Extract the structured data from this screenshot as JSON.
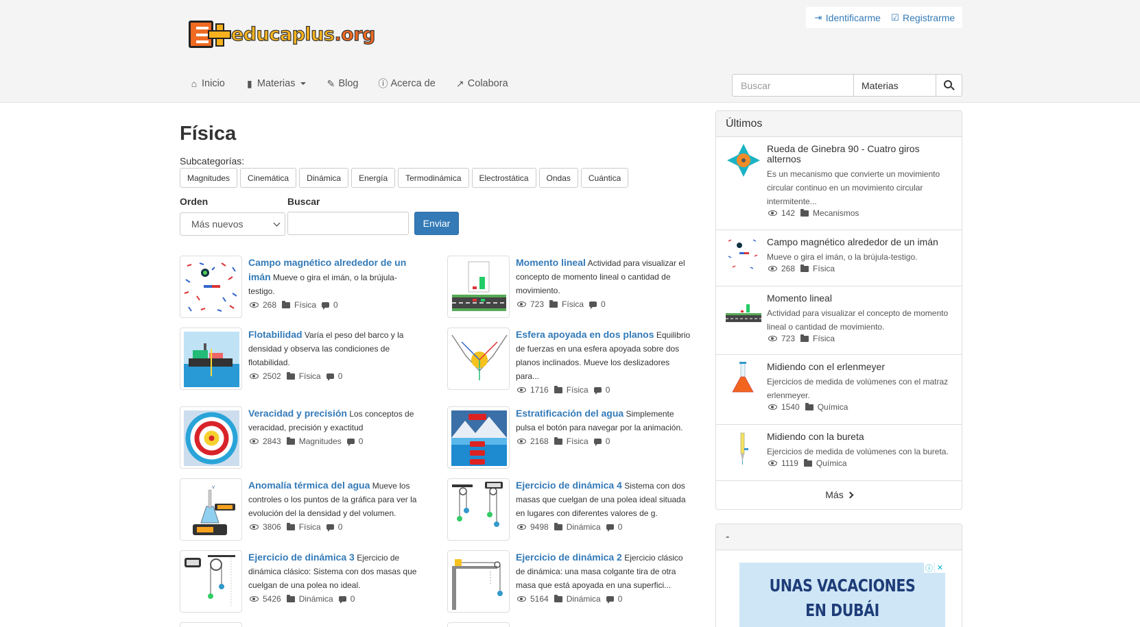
{
  "brand": {
    "logo_main": "educaplus",
    "logo_tld": ".org"
  },
  "auth": {
    "login": "Identificarme",
    "register": "Registrarme"
  },
  "nav": [
    {
      "label": "Inicio",
      "icon": "home-icon"
    },
    {
      "label": "Materias",
      "icon": "book-icon",
      "dropdown": true
    },
    {
      "label": "Blog",
      "icon": "pencil-icon"
    },
    {
      "label": "Acerca de",
      "icon": "info-icon"
    },
    {
      "label": "Colabora",
      "icon": "share-icon"
    }
  ],
  "search": {
    "placeholder": "Buscar",
    "scope": "Materias"
  },
  "page": {
    "title": "Física",
    "subcategories_label": "Subcategorías:",
    "subcategories": [
      "Magnitudes",
      "Cinemática",
      "Dinámica",
      "Energía",
      "Termodinámica",
      "Electrostática",
      "Ondas",
      "Cuántica"
    ],
    "order_label": "Orden",
    "order_value": "Más nuevos",
    "search_label": "Buscar",
    "submit": "Enviar"
  },
  "items": [
    {
      "title": "Campo magnético alrededor de un imán",
      "desc": "Mueve o gira el imán, o la brújula-testigo.",
      "views": "268",
      "category": "Física",
      "comments": "0"
    },
    {
      "title": "Momento lineal",
      "desc": "Actividad para visualizar el concepto de momento lineal o cantidad de movimiento.",
      "views": "723",
      "category": "Física",
      "comments": "0"
    },
    {
      "title": "Flotabilidad",
      "desc": "Varía el peso del barco y la densidad y observa las condiciones de flotabilidad.",
      "views": "2502",
      "category": "Física",
      "comments": "0"
    },
    {
      "title": "Esfera apoyada en dos planos",
      "desc": "Equilibrio de fuerzas en una esfera apoyada sobre dos planos inclinados. Mueve los deslizadores para...",
      "views": "1716",
      "category": "Física",
      "comments": "0"
    },
    {
      "title": "Veracidad y precisión",
      "desc": "Los conceptos de veracidad, precisión y exactitud",
      "views": "2843",
      "category": "Magnitudes",
      "comments": "0"
    },
    {
      "title": "Estratificación del agua",
      "desc": "Simplemente pulsa el botón para navegar por la animación.",
      "views": "2168",
      "category": "Física",
      "comments": "0"
    },
    {
      "title": "Anomalía térmica del agua",
      "desc": "Mueve los controles o los puntos de la gráfica para ver la evolución del la densidad y del volumen.",
      "views": "3806",
      "category": "Física",
      "comments": "0"
    },
    {
      "title": "Ejercicio de dinámica 4",
      "desc": "Sistema con dos masas que cuelgan de una polea ideal situada en lugares con diferentes valores de g.",
      "views": "9498",
      "category": "Dinámica",
      "comments": "0"
    },
    {
      "title": "Ejercicio de dinámica 3",
      "desc": "Ejercicio de dinámica clásico: Sistema con dos masas que cuelgan de una polea no ideal.",
      "views": "5426",
      "category": "Dinámica",
      "comments": "0"
    },
    {
      "title": "Ejercicio de dinámica 2",
      "desc": "Ejercicio clásico de dinámica: una masa colgante tira de otra masa que está apoyada en una superfici...",
      "views": "5164",
      "category": "Dinámica",
      "comments": "0"
    }
  ],
  "sidebar": {
    "latest_title": "Últimos",
    "latest": [
      {
        "title": "Rueda de Ginebra 90 - Cuatro giros alternos",
        "desc": "Es un mecanismo que convierte un movimiento circular continuo en un movimiento circular intermitente...",
        "views": "142",
        "category": "Mecanismos"
      },
      {
        "title": "Campo magnético alrededor de un imán",
        "desc": "Mueve o gira el imán, o la brújula-testigo.",
        "views": "268",
        "category": "Física"
      },
      {
        "title": "Momento lineal",
        "desc": "Actividad para visualizar el concepto de momento lineal o cantidad de movimiento.",
        "views": "723",
        "category": "Física"
      },
      {
        "title": "Midiendo con el erlenmeyer",
        "desc": "Ejercicios de medida de volúmenes con el matraz erlenmeyer.",
        "views": "1540",
        "category": "Química"
      },
      {
        "title": "Midiendo con la bureta",
        "desc": "Ejercicios de medida de volúmenes con la bureta.",
        "views": "1119",
        "category": "Química"
      }
    ],
    "more": "Más",
    "ad_panel_title": "-",
    "ad_text_1": "UNAS VACACIONES",
    "ad_text_2": "EN DUBÁI"
  },
  "colors": {
    "link": "#337ab7",
    "header_bg": "#f4f4f4",
    "button": "#337ab7"
  }
}
